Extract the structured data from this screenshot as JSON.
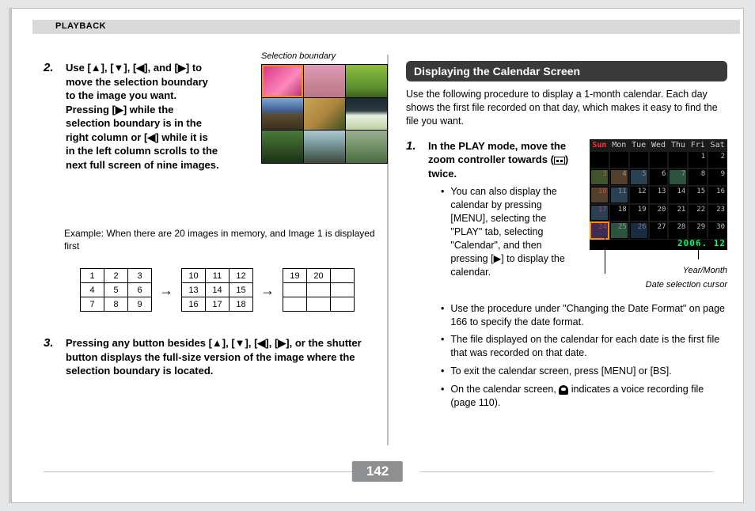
{
  "header": {
    "section": "PLAYBACK"
  },
  "page_number": "142",
  "left": {
    "step2": {
      "num": "2.",
      "body": "Use [▲], [▼], [◀], and [▶] to move the selection boundary to the image you want. Pressing [▶] while the selection boundary is in the right column or [◀] while it is in the left column scrolls to the next full screen of nine images.",
      "thumb_label": "Selection boundary",
      "example": "Example: When there are 20 images in memory, and Image 1 is displayed first"
    },
    "grids": {
      "g1": [
        [
          "1",
          "2",
          "3"
        ],
        [
          "4",
          "5",
          "6"
        ],
        [
          "7",
          "8",
          "9"
        ]
      ],
      "g2": [
        [
          "10",
          "11",
          "12"
        ],
        [
          "13",
          "14",
          "15"
        ],
        [
          "16",
          "17",
          "18"
        ]
      ],
      "g3": [
        [
          "19",
          "20",
          ""
        ],
        [
          "",
          "",
          ""
        ],
        [
          "",
          "",
          ""
        ]
      ]
    },
    "step3": {
      "num": "3.",
      "body": "Pressing any button besides [▲], [▼], [◀], [▶], or the shutter button displays the full-size version of the image where the selection boundary is located."
    }
  },
  "right": {
    "heading": "Displaying the Calendar Screen",
    "intro": "Use the following procedure to display a 1-month calendar. Each day shows the first file recorded on that day, which makes it easy to find the file you want.",
    "step1": {
      "num": "1.",
      "body_a": "In the PLAY mode, move the zoom controller towards (",
      "body_b": ") twice."
    },
    "bullets_narrow": [
      "You can also display the calendar by pressing [MENU], selecting the \"PLAY\" tab, selecting \"Calendar\", and then pressing [▶] to display the calendar."
    ],
    "bullets_wide": [
      "Use the procedure under \"Changing the Date Format\" on page 166 to specify the date format.",
      "The file displayed on the calendar for each date is the first file that was recorded on that date.",
      "To exit the calendar screen, press [MENU] or [BS]."
    ],
    "bullet_mic_a": "On the calendar screen, ",
    "bullet_mic_b": " indicates a voice recording file (page 110).",
    "calendar": {
      "days": [
        "Sun",
        "Mon",
        "Tue",
        "Wed",
        "Thu",
        "Fri",
        "Sat"
      ],
      "cells": [
        "",
        "",
        "",
        "",
        "",
        "1",
        "2",
        "3",
        "4",
        "5",
        "6",
        "7",
        "8",
        "9",
        "10",
        "11",
        "12",
        "13",
        "14",
        "15",
        "16",
        "17",
        "18",
        "19",
        "20",
        "21",
        "22",
        "23",
        "24",
        "25",
        "26",
        "27",
        "28",
        "29",
        "30"
      ],
      "year_month": "2006. 12",
      "label_year_month": "Year/Month",
      "label_cursor": "Date selection cursor"
    }
  }
}
